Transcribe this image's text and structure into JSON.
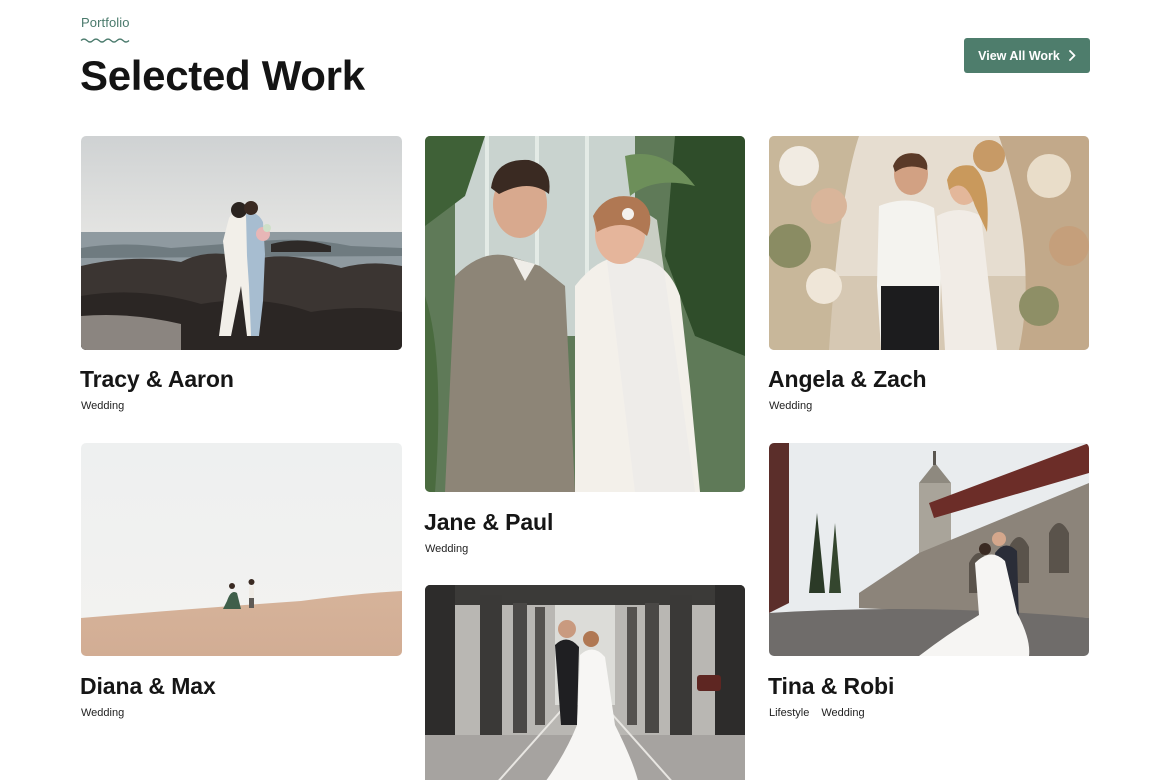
{
  "header": {
    "eyebrow": "Portfolio",
    "title": "Selected Work",
    "cta_label": "View All Work",
    "cta_icon": "chevron-right-icon"
  },
  "colors": {
    "accent": "#4e7d6c",
    "eyebrow": "#4a7a6c",
    "text": "#141414",
    "background": "#ffffff"
  },
  "projects": [
    {
      "title": "Tracy & Aaron",
      "tags": [
        "Wedding"
      ]
    },
    {
      "title": "Jane & Paul",
      "tags": [
        "Wedding"
      ]
    },
    {
      "title": "Angela & Zach",
      "tags": [
        "Wedding"
      ]
    },
    {
      "title": "Diana & Max",
      "tags": [
        "Wedding"
      ]
    },
    {
      "title": "Tina & Robi",
      "tags": [
        "Lifestyle",
        "Wedding"
      ]
    },
    {
      "title": "",
      "tags": []
    }
  ]
}
